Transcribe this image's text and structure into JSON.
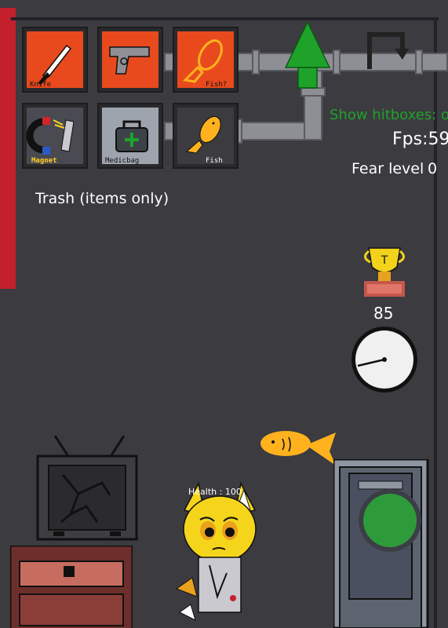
{
  "inventory": [
    {
      "name": "knife-slot",
      "label": "Knife",
      "bg": "#e84a1d"
    },
    {
      "name": "gun-slot",
      "label": "",
      "bg": "#e84a1d"
    },
    {
      "name": "fish-question-slot",
      "label": "Fish?",
      "bg": "#e84a1d"
    },
    {
      "name": "magnet-slot",
      "label": "Magnet",
      "bg": "#4a4a52"
    },
    {
      "name": "medicbag-slot",
      "label": "Medicbag",
      "bg": "#9ea4ad"
    },
    {
      "name": "fish-slot",
      "label": "Fish",
      "bg": "#3b3b40"
    }
  ],
  "trash_label": "Trash (items only)",
  "hud": {
    "hitboxes": "Show hitboxes: off",
    "fps": "Fps:59",
    "fear_label": "Fear level",
    "fear_value": "0"
  },
  "trophy_letter": "T",
  "timer_value": "85",
  "character": {
    "health_label": "Health : 100"
  },
  "colors": {
    "hitboxes_green": "#1fa22a",
    "red_bar": "#c3202c",
    "slot_orange": "#e84a1d",
    "fish_yellow": "#ffb21e",
    "door_button_green": "#2e9b3b"
  },
  "icons": [
    "knife-icon",
    "pistol-icon",
    "fish-icon",
    "magnet-icon",
    "medicbag-icon",
    "tree-icon",
    "restart-icon",
    "trophy-icon",
    "clock-icon",
    "tv-icon",
    "dresser-icon",
    "door-icon"
  ]
}
